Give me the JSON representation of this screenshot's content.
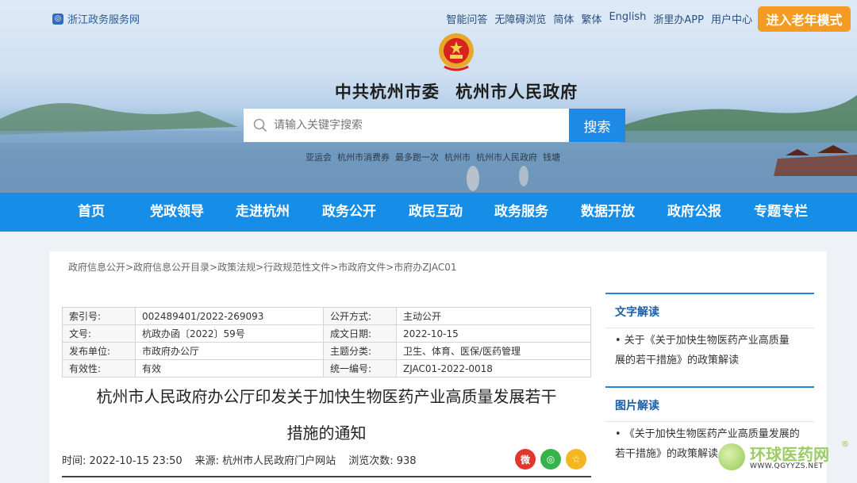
{
  "header": {
    "brand": "浙江政务服务网",
    "top_links": [
      "智能问答",
      "无障碍浏览",
      "简体",
      "繁体",
      "English",
      "浙里办APP",
      "用户中心"
    ],
    "elder_mode": "进入老年模式",
    "gov_title_1": "中共杭州市委",
    "gov_title_2": "杭州市人民政府",
    "search_placeholder": "请输入关键字搜索",
    "search_button": "搜索",
    "hot_words": [
      "亚运会",
      "杭州市消费券",
      "最多跑一次",
      "杭州市",
      "杭州市人民政府",
      "钱塘"
    ]
  },
  "nav": [
    "首页",
    "党政领导",
    "走进杭州",
    "政务公开",
    "政民互动",
    "政务服务",
    "数据开放",
    "政府公报",
    "专题专栏"
  ],
  "main": {
    "breadcrumb": "政府信息公开>政府信息公开目录>政策法规>行政规范性文件>市政府文件>市府办ZJAC01",
    "meta": [
      [
        "索引号:",
        "002489401/2022-269093",
        "公开方式:",
        "主动公开"
      ],
      [
        "文号:",
        "杭政办函〔2022〕59号",
        "成文日期:",
        "2022-10-15"
      ],
      [
        "发布单位:",
        "市政府办公厅",
        "主题分类:",
        "卫生、体育、医保/医药管理"
      ],
      [
        "有效性:",
        "有效",
        "统一编号:",
        "ZJAC01-2022-0018"
      ]
    ],
    "doc_title_line1": "杭州市人民政府办公厅印发关于加快生物医药产业高质量发展若干",
    "doc_title_line2": "措施的通知",
    "time": "时间: 2022-10-15 23:50",
    "source": "来源: 杭州市人民政府门户网站",
    "views": "浏览次数: 938"
  },
  "sidebar": {
    "text_title": "文字解读",
    "text_item_1": "• 关于《关于加快生物医药产业高质量",
    "text_item_2": "展的若干措施》的政策解读",
    "pic_title": "图片解读",
    "pic_item_1": "• 《关于加快生物医药产业高质量发展的",
    "pic_item_2": "若干措施》的政策解读"
  },
  "watermark": {
    "name": "环球医药网",
    "url": "WWW.QGYYZS.NET",
    "reg": "®"
  },
  "colors": {
    "nav_blue": "#168de6",
    "search_blue": "#1f8ae6",
    "elder_orange": "#f39b24",
    "side_title_blue": "#1a5fa8"
  }
}
